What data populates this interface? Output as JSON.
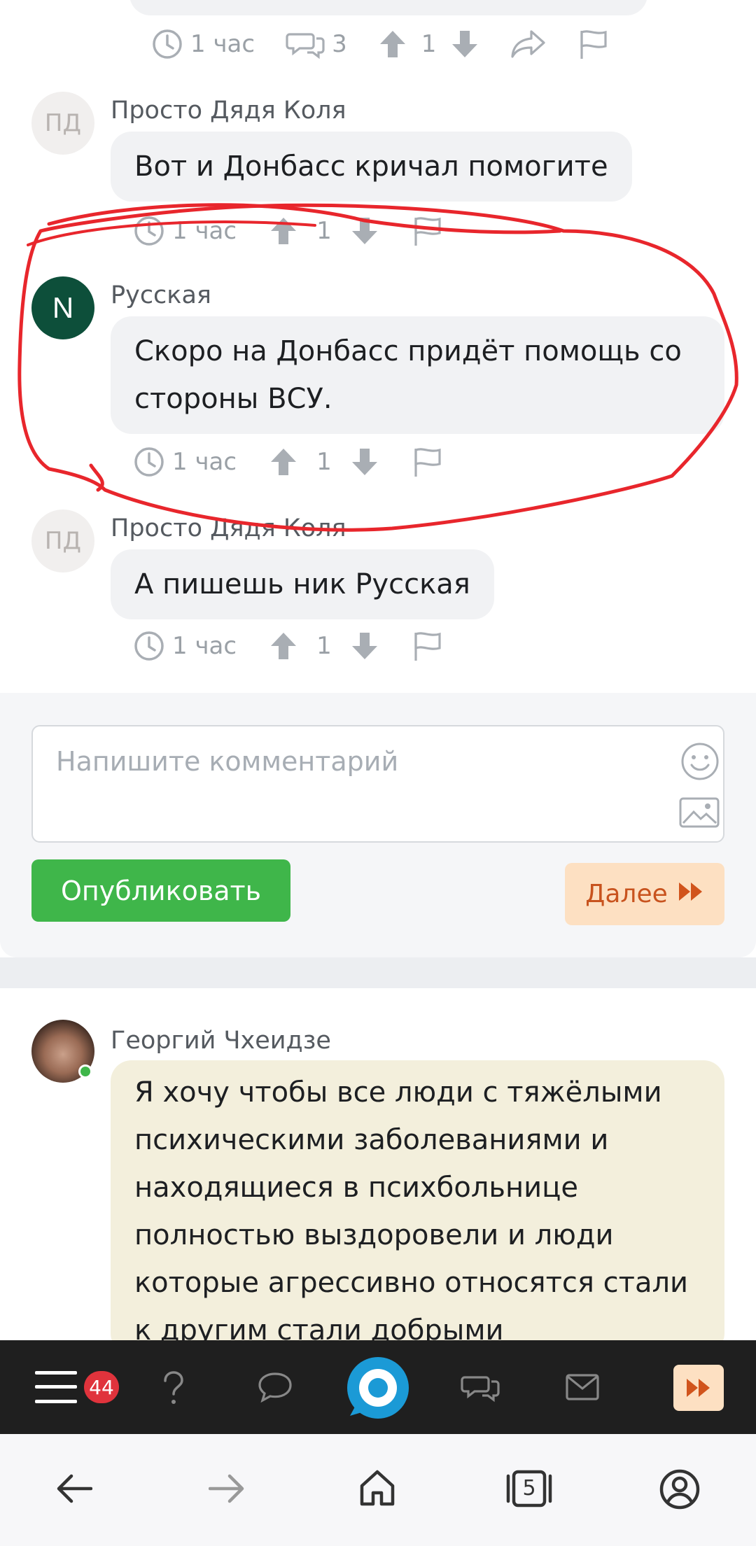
{
  "top_meta": {
    "time": "1 час",
    "comments": "3",
    "votes": "1"
  },
  "comments": [
    {
      "initials": "ПД",
      "author": "Просто Дядя Коля",
      "text": "Вот и Донбасс кричал помогите",
      "time": "1 час",
      "votes": "1"
    },
    {
      "initials": "N",
      "author": "Русская",
      "text_line1": "Скоро на Донбасс придёт помощь со",
      "text_line2": "стороны ВСУ.",
      "time": "1 час",
      "votes": "1"
    },
    {
      "initials": "ПД",
      "author": "Просто Дядя Коля",
      "text": "А пишешь ник Русская",
      "time": "1 час",
      "votes": "1"
    }
  ],
  "composer": {
    "placeholder": "Напишите комментарий",
    "publish_label": "Опубликовать",
    "next_label": "Далее"
  },
  "next_post": {
    "author": "Георгий Чхеидзе",
    "lines": [
      "Я хочу чтобы все люди с тяжёлыми",
      "психическими заболеваниями и",
      "находящиеся в психбольнице",
      "полностью выздоровели и люди",
      "которые агрессивно относятся стали",
      "к другим стали добрыми"
    ]
  },
  "nav": {
    "badge": "44"
  },
  "system": {
    "tabs_count": "5"
  },
  "colors": {
    "accent_green": "#3fb64a",
    "accent_orange": "#c8531e",
    "badge_red": "#e0333c",
    "annotation_red": "#e8262c"
  }
}
